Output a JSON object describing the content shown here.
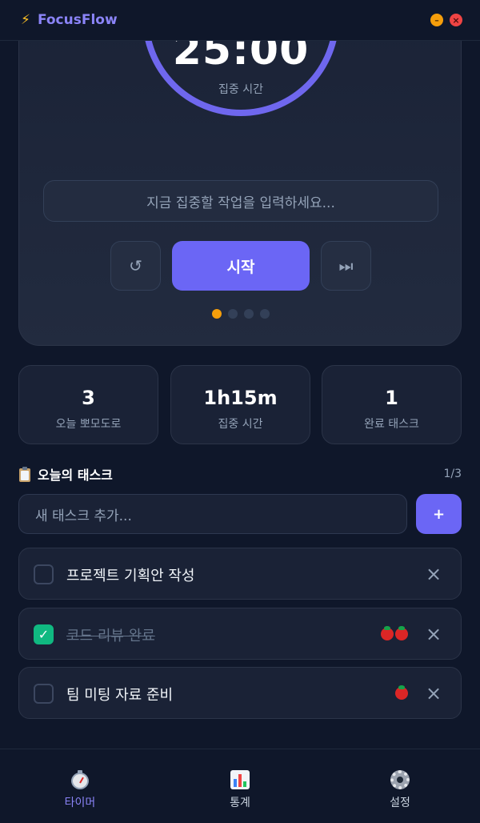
{
  "app": {
    "name": "FocusFlow",
    "icon": "lightning-icon"
  },
  "window": {
    "minimize_icon": "minimize-icon",
    "close_icon": "close-icon"
  },
  "timer": {
    "time": "25:00",
    "label": "집중 시간",
    "task_placeholder": "지금 집중할 작업을 입력하세요...",
    "reset_icon": "↺",
    "start_label": "시작",
    "skip_icon": "⏭",
    "sessions_total": 4,
    "sessions_active_index": 0,
    "ring_color": "#6f67ee"
  },
  "stats": [
    {
      "value": "3",
      "label": "오늘 뽀모도로"
    },
    {
      "value": "1h15m",
      "label": "집중 시간"
    },
    {
      "value": "1",
      "label": "완료 태스크"
    }
  ],
  "tasks": {
    "title": "오늘의 태스크",
    "count": "1/3",
    "new_placeholder": "새 태스크 추가...",
    "add_label": "+",
    "items": [
      {
        "text": "프로젝트 기획안 작성",
        "done": false,
        "pomodoros": 0
      },
      {
        "text": "코드 리뷰 완료",
        "done": true,
        "pomodoros": 2
      },
      {
        "text": "팀 미팅 자료 준비",
        "done": false,
        "pomodoros": 1
      }
    ],
    "remove_icon": "×"
  },
  "nav": [
    {
      "label": "타이머",
      "icon": "stopwatch-icon",
      "active": true
    },
    {
      "label": "통계",
      "icon": "bar-chart-icon",
      "active": false
    },
    {
      "label": "설정",
      "icon": "gear-icon",
      "active": false
    }
  ],
  "colors": {
    "accent": "#6b66f5",
    "brand": "#8b84f8",
    "success": "#10b981",
    "warning": "#f59e0b"
  }
}
